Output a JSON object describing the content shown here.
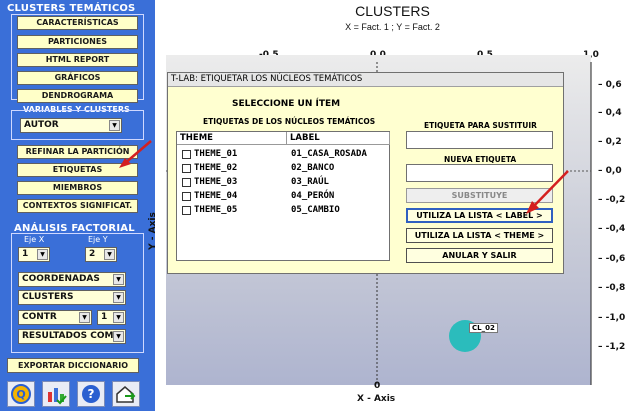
{
  "left": {
    "clusters_title": "CLUSTERS TEMÁTICOS",
    "buttons1": [
      "CARACTERÍSTICAS",
      "PARTICIONES",
      "HTML REPORT",
      "GRÁFICOS",
      "DENDROGRAMA"
    ],
    "vars_title": "VARIABLES Y CLUSTERS",
    "autor_value": "AUTOR",
    "buttons2": [
      "REFINAR LA PARTICIÓN",
      "ETIQUETAS",
      "MIEMBROS",
      "CONTEXTOS SIGNIFICAT."
    ],
    "factorial_title": "ANÁLISIS FACTORIAL",
    "eje_x_label": "Eje X",
    "eje_y_label": "Eje Y",
    "eje_x_value": "1",
    "eje_y_value": "2",
    "coord_value": "COORDENADAS",
    "clusters_value": "CLUSTERS",
    "contr_value": "CONTR",
    "contr_num": "1",
    "resultados_value": "RESULTADOS COMI",
    "export_label": "EXPORTAR DICCIONARIO",
    "icons": [
      "q-logo-icon",
      "chart-check-icon",
      "help-icon",
      "home-export-icon"
    ]
  },
  "chart": {
    "title": "CLUSTERS",
    "subtitle": "X = Fact. 1 ; Y = Fact. 2",
    "x_axis_label": "X - Axis",
    "y_axis_label": "Y - Axis",
    "x_ticks": [
      "-0,5",
      "0,0",
      "0,5",
      "1,0"
    ],
    "y_ticks": [
      "0,6",
      "0,4",
      "0,2",
      "0,0",
      "-0,2",
      "-0,4",
      "-0,6",
      "-0,8",
      "-1,0",
      "-1,2"
    ],
    "x_zero_label": "0",
    "point_label": "CL_02",
    "point_color": "#2bbcbc"
  },
  "chart_data": {
    "type": "scatter",
    "title": "CLUSTERS",
    "subtitle": "X = Fact. 1 ; Y = Fact. 2",
    "xlabel": "X - Axis",
    "ylabel": "Y - Axis",
    "xlim": [
      -0.7,
      1.0
    ],
    "ylim": [
      -1.3,
      0.65
    ],
    "points": [
      {
        "label": "CL_02",
        "x": 0.42,
        "y": -1.08
      }
    ]
  },
  "dialog": {
    "window_title": "T-LAB: ETIQUETAR LOS NÚCLEOS TEMÁTICOS",
    "select_title": "SELECCIONE UN ÍTEM",
    "labels_title": "ETIQUETAS DE LOS NÚCLEOS TEMÁTICOS",
    "col_theme": "THEME",
    "col_label": "LABEL",
    "rows": [
      {
        "theme": "THEME_01",
        "label": "01_CASA_ROSADA"
      },
      {
        "theme": "THEME_02",
        "label": "02_BANCO"
      },
      {
        "theme": "THEME_03",
        "label": "03_RAÚL"
      },
      {
        "theme": "THEME_04",
        "label": "04_PERÓN"
      },
      {
        "theme": "THEME_05",
        "label": "05_CAMBIO"
      }
    ],
    "replace_label": "ETIQUETA PARA SUSTITUIR",
    "new_label": "NUEVA ETIQUETA",
    "substitute_btn": "SUBSTITUYE",
    "use_label_btn": "UTILIZA  LA LISTA < LABEL >",
    "use_theme_btn": "UTILIZA  LA LISTA < THEME >",
    "cancel_btn": "ANULAR  Y SALIR"
  },
  "colors": {
    "panel": "#3a6fd8",
    "button": "#ffffc8",
    "arrow": "#d42020",
    "dialog": "#ffffd0"
  }
}
